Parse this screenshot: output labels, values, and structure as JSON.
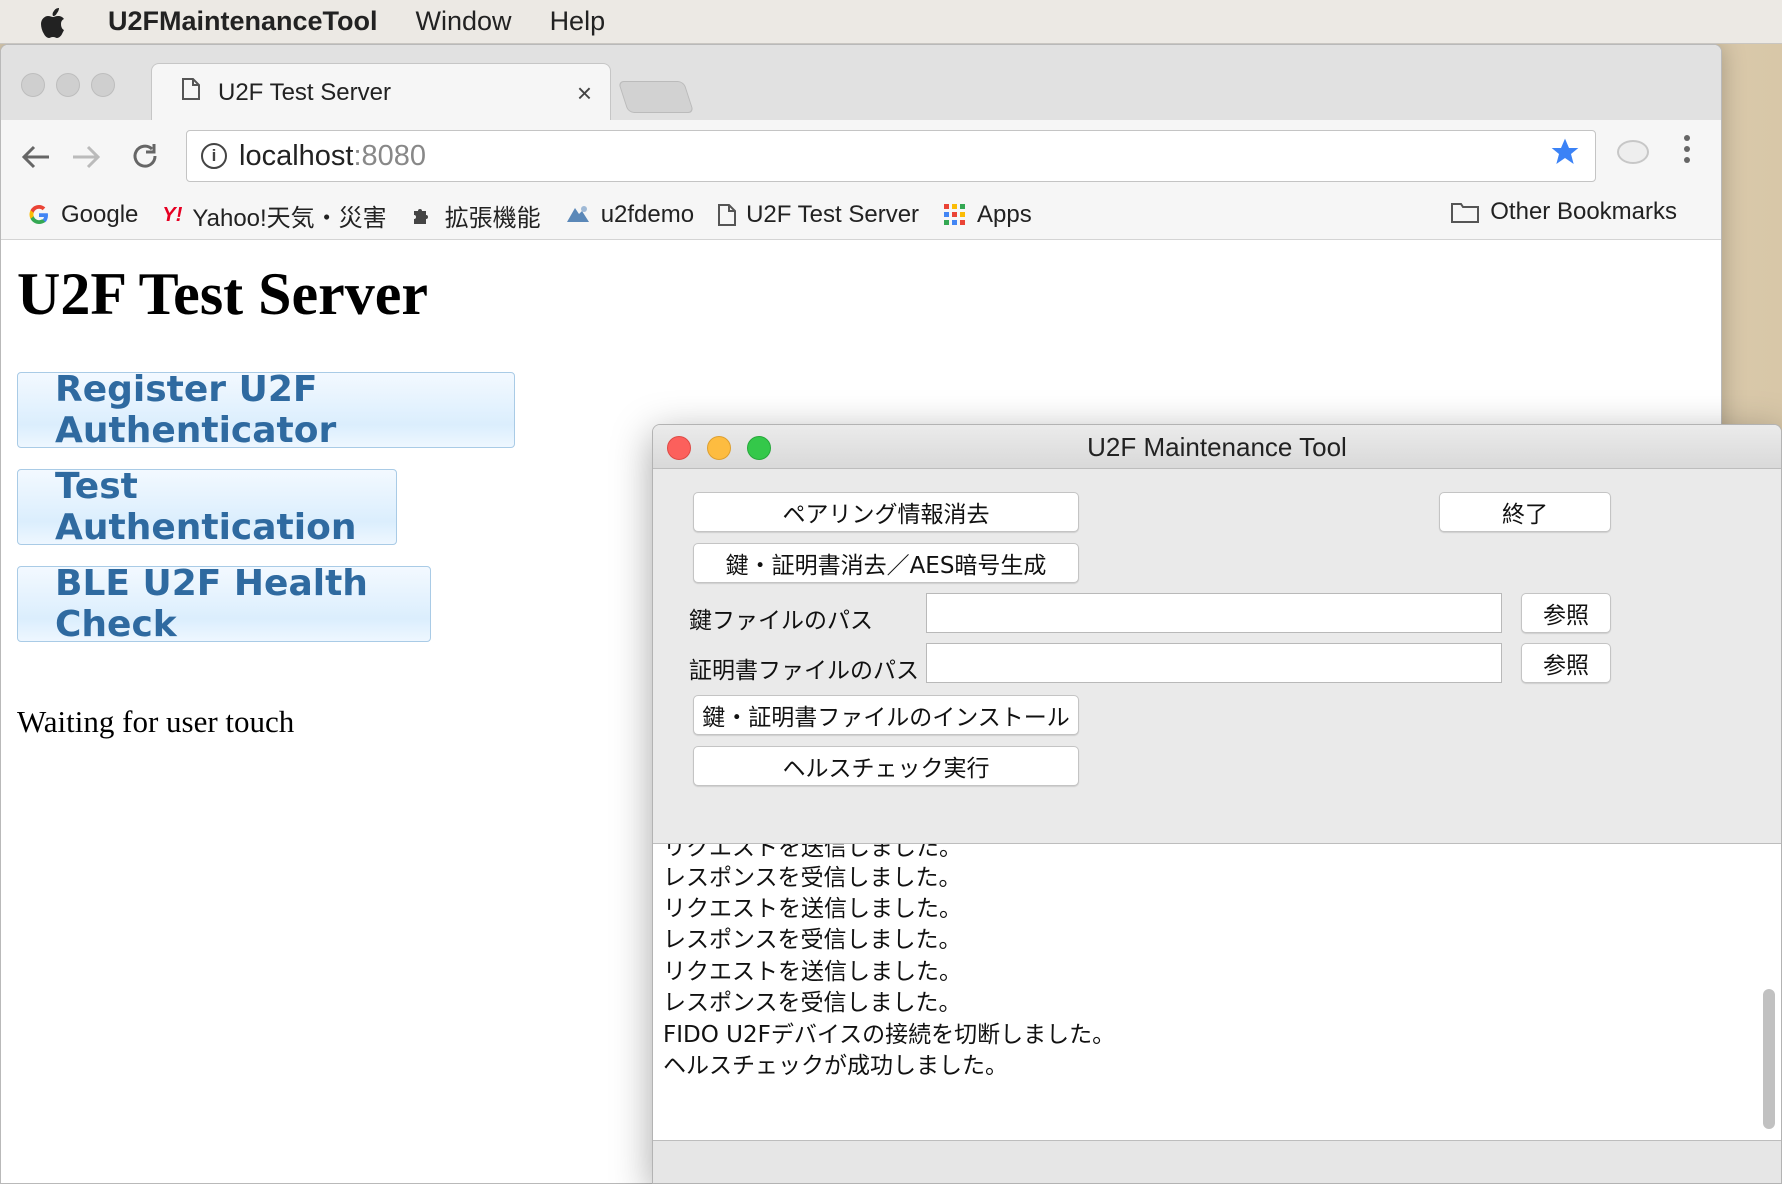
{
  "menubar": {
    "app_name": "U2FMaintenanceTool",
    "items": [
      "Window",
      "Help"
    ]
  },
  "browser": {
    "tab_title": "U2F Test Server",
    "close_glyph": "×",
    "url_host": "localhost",
    "url_port": ":8080",
    "bookmarks": [
      {
        "label": "Google",
        "icon": "google-icon"
      },
      {
        "label": "Yahoo!天気・災害",
        "icon": "yahoo-icon"
      },
      {
        "label": "拡張機能",
        "icon": "puzzle-icon"
      },
      {
        "label": "u2fdemo",
        "icon": "site-icon"
      },
      {
        "label": "U2F Test Server",
        "icon": "document-icon"
      },
      {
        "label": "Apps",
        "icon": "apps-grid-icon"
      }
    ],
    "other_bookmarks": "Other Bookmarks"
  },
  "page": {
    "heading": "U2F Test Server",
    "buttons": [
      "Register U2F Authenticator",
      "Test Authentication",
      "BLE U2F Health Check"
    ],
    "status": "Waiting for user touch"
  },
  "tool": {
    "title": "U2F Maintenance Tool",
    "erase_pairing": "ペアリング情報消去",
    "quit": "終了",
    "erase_keys": "鍵・証明書消去／AES暗号生成",
    "key_path_label": "鍵ファイルのパス",
    "cert_path_label": "証明書ファイルのパス",
    "key_path_value": "",
    "cert_path_value": "",
    "browse": "参照",
    "install": "鍵・証明書ファイルのインストール",
    "health_check": "ヘルスチェック実行",
    "log": [
      "リクエストを送信しました。",
      "レスポンスを受信しました。",
      "リクエストを送信しました。",
      "レスポンスを受信しました。",
      "リクエストを送信しました。",
      "レスポンスを受信しました。",
      "FIDO U2Fデバイスの接続を切断しました。",
      "ヘルスチェックが成功しました。"
    ]
  },
  "colors": {
    "star": "#3b82f6",
    "web_button_text": "#2f6aa0",
    "close": "#fc605c",
    "minimize": "#fdbc40",
    "zoom": "#34c84a"
  }
}
